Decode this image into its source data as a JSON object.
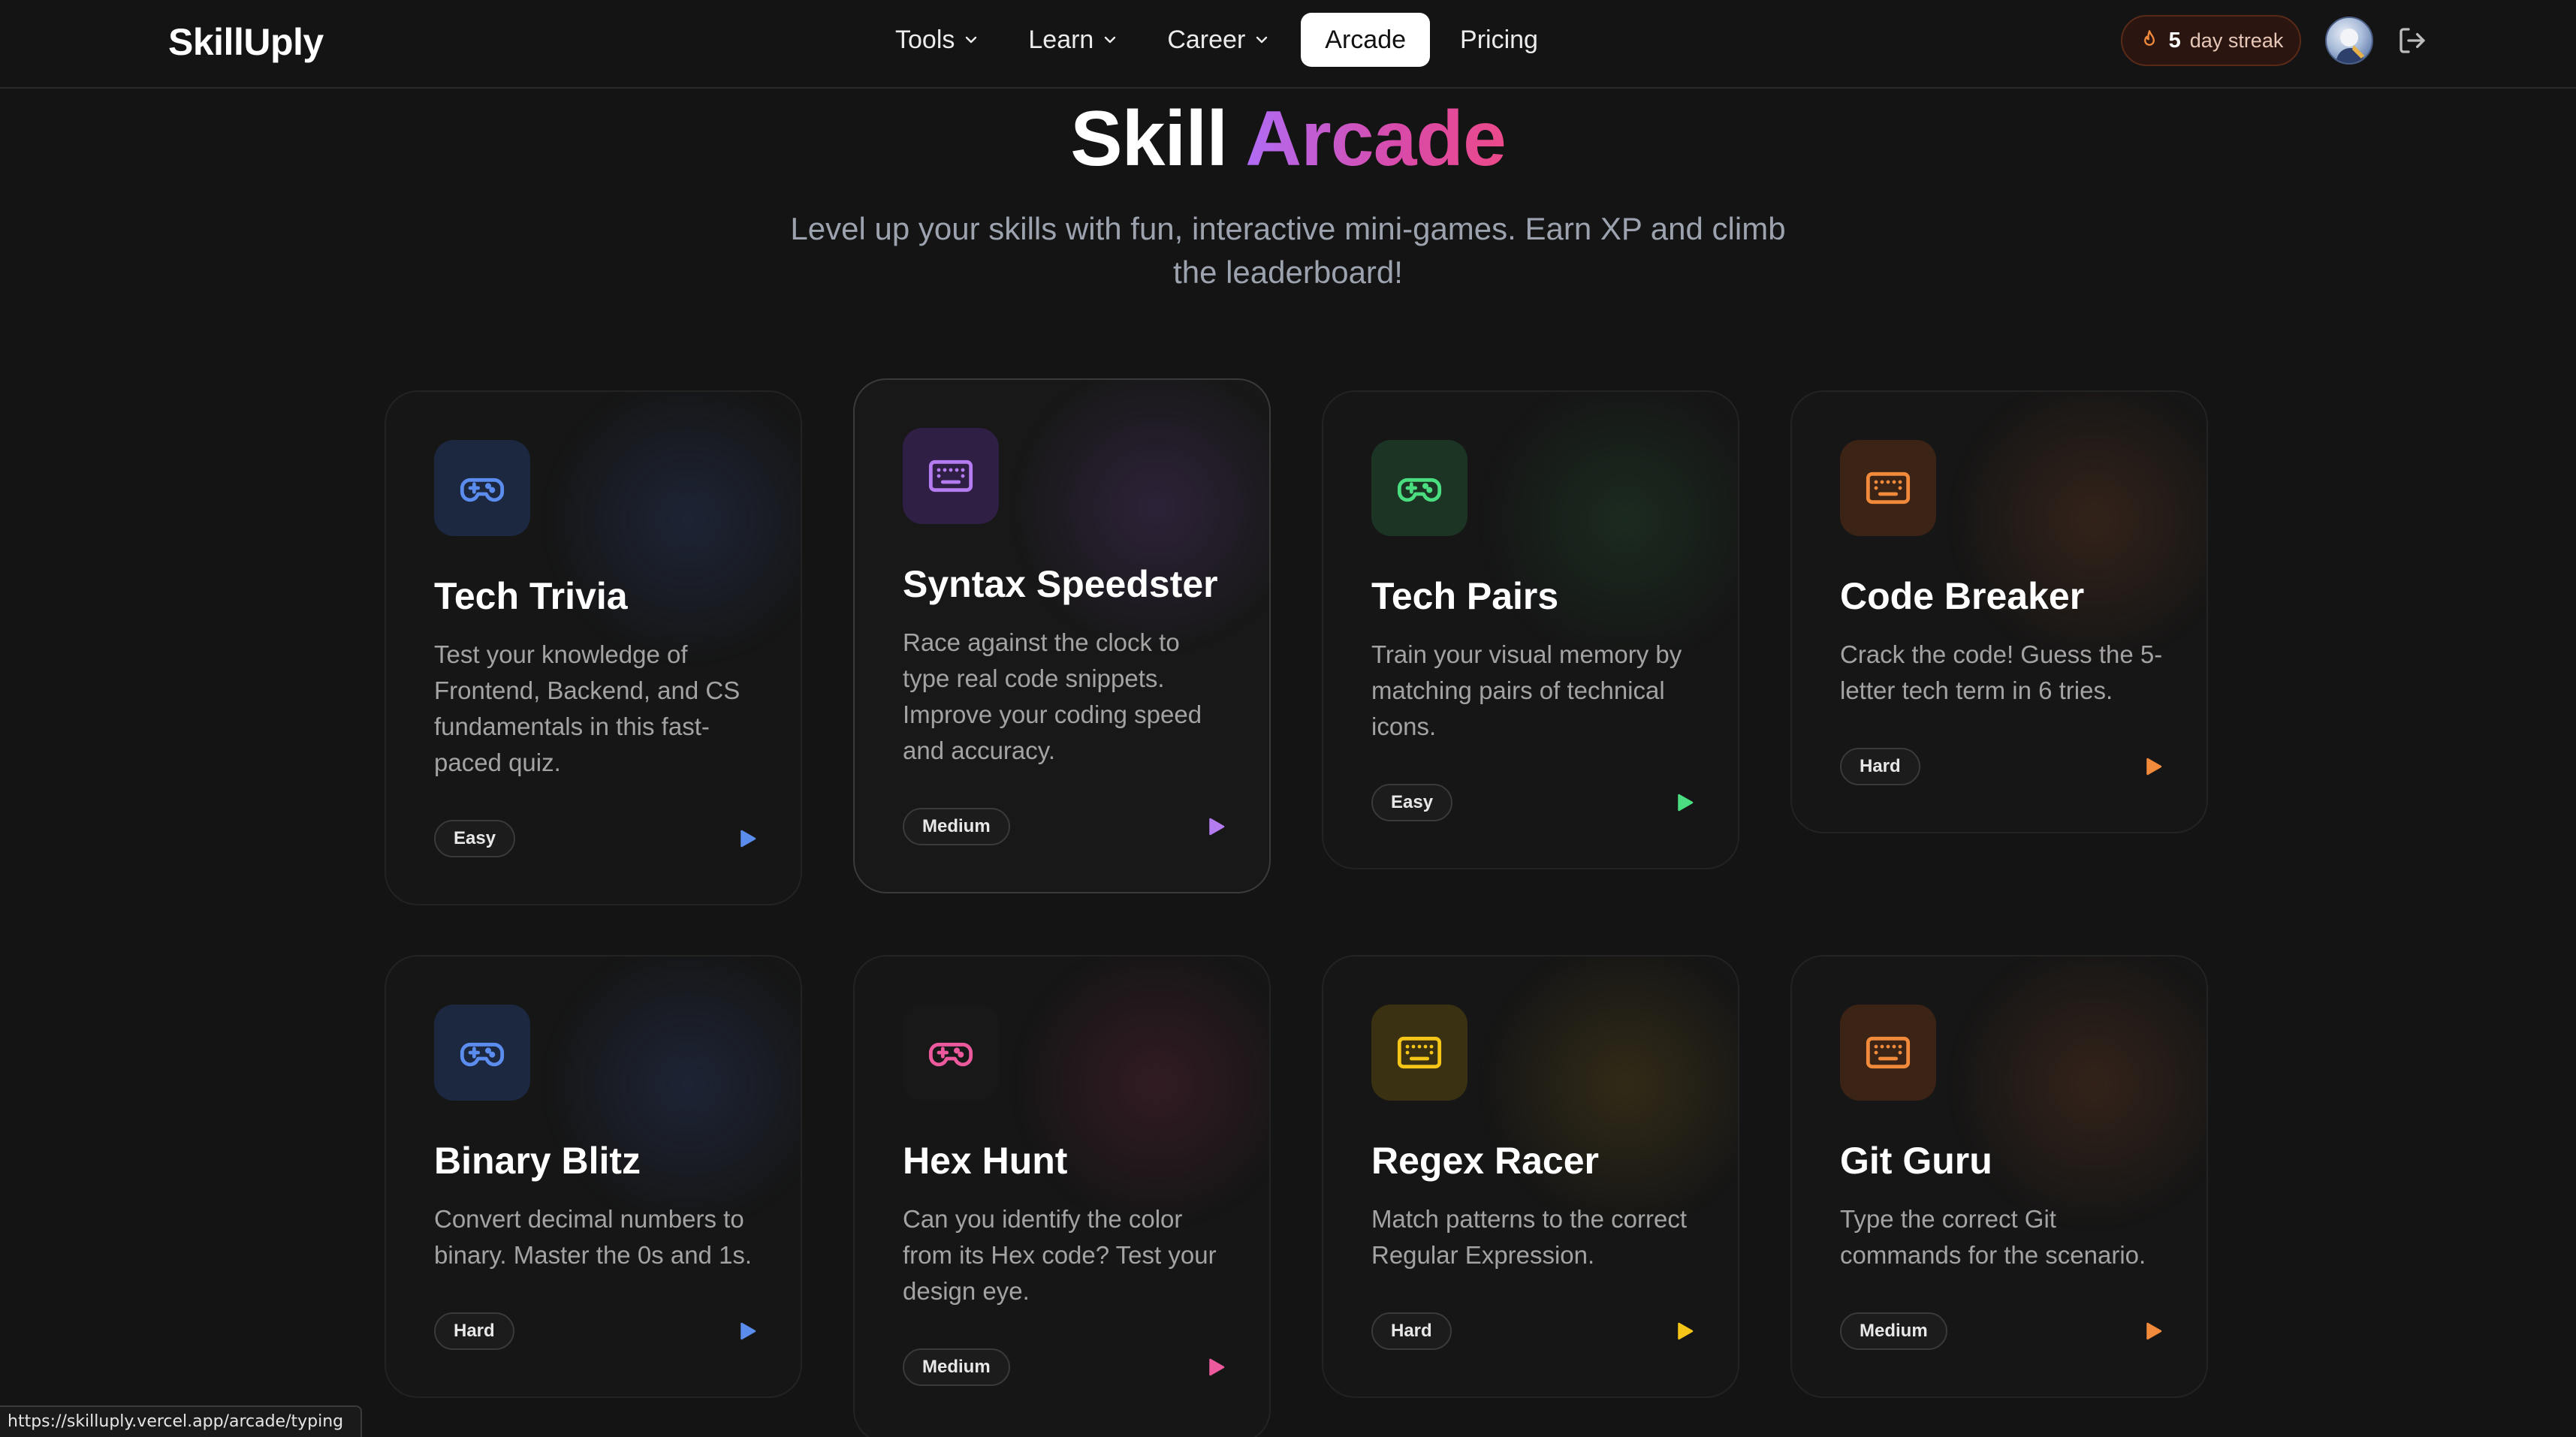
{
  "brand": "SkillUply",
  "nav": {
    "items": [
      {
        "label": "Tools",
        "dropdown": true,
        "active": false
      },
      {
        "label": "Learn",
        "dropdown": true,
        "active": false
      },
      {
        "label": "Career",
        "dropdown": true,
        "active": false
      },
      {
        "label": "Arcade",
        "dropdown": false,
        "active": true
      },
      {
        "label": "Pricing",
        "dropdown": false,
        "active": false
      }
    ]
  },
  "streak": {
    "count": "5",
    "label": "day streak",
    "icon": "flame-icon"
  },
  "hero": {
    "title_part1": "Skill",
    "title_part2": "Arcade",
    "subtitle": "Level up your skills with fun, interactive mini-games. Earn XP and climb the leaderboard!"
  },
  "games": [
    {
      "title": "Tech Trivia",
      "description": "Test your knowledge of Frontend, Backend, and CS fundamentals in this fast-paced quiz.",
      "difficulty": "Easy",
      "icon": "gamepad-icon",
      "accent": "#5b8def",
      "icon_bg": "#1c2740"
    },
    {
      "title": "Syntax Speedster",
      "description": "Race against the clock to type real code snippets. Improve your coding speed and accuracy.",
      "difficulty": "Medium",
      "icon": "keyboard-icon",
      "accent": "#b57cf2",
      "icon_bg": "#2f1f45"
    },
    {
      "title": "Tech Pairs",
      "description": "Train your visual memory by matching pairs of technical icons.",
      "difficulty": "Easy",
      "icon": "gamepad-icon",
      "accent": "#4ade80",
      "icon_bg": "#1b3424"
    },
    {
      "title": "Code Breaker",
      "description": "Crack the code! Guess the 5-letter tech term in 6 tries.",
      "difficulty": "Hard",
      "icon": "keyboard-icon",
      "accent": "#f28a3b",
      "icon_bg": "#3b2315"
    },
    {
      "title": "Binary Blitz",
      "description": "Convert decimal numbers to binary. Master the 0s and 1s.",
      "difficulty": "Hard",
      "icon": "gamepad-icon",
      "accent": "#5b8def",
      "icon_bg": "#1c2740"
    },
    {
      "title": "Hex Hunt",
      "description": "Can you identify the color from its Hex code? Test your design eye.",
      "difficulty": "Medium",
      "icon": "gamepad-icon",
      "accent": "#ec5a9d",
      "icon_bg": "#181818"
    },
    {
      "title": "Regex Racer",
      "description": "Match patterns to the correct Regular Expression.",
      "difficulty": "Hard",
      "icon": "keyboard-icon",
      "accent": "#f5c518",
      "icon_bg": "#3a3012"
    },
    {
      "title": "Git Guru",
      "description": "Type the correct Git commands for the scenario.",
      "difficulty": "Medium",
      "icon": "keyboard-icon",
      "accent": "#f28a3b",
      "icon_bg": "#3b2315"
    }
  ],
  "status_url": "https://skilluply.vercel.app/arcade/typing"
}
